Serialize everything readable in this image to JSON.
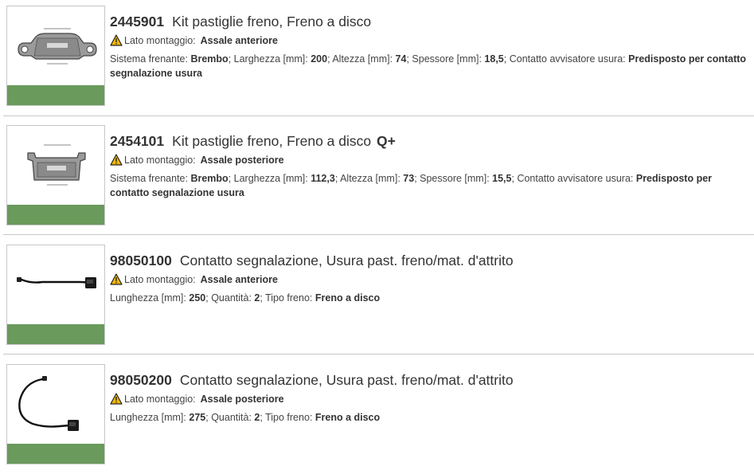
{
  "colors": {
    "accent_bar": "#6a9a5c",
    "separator": "#c8c8c8",
    "warning": "#f2b705"
  },
  "products": [
    {
      "code": "2445901",
      "name": "Kit pastiglie freno, Freno a disco",
      "badge": "",
      "image_icon": "brake-pad-front-icon",
      "mount_label": "Lato montaggio:",
      "mount_value": "Assale anteriore",
      "attributes": [
        {
          "label": "Sistema frenante:",
          "value": "Brembo"
        },
        {
          "label": "Larghezza [mm]:",
          "value": "200"
        },
        {
          "label": "Altezza [mm]:",
          "value": "74"
        },
        {
          "label": "Spessore [mm]:",
          "value": "18,5"
        },
        {
          "label": "Contatto avvisatore usura:",
          "value": "Predisposto per contatto segnalazione usura"
        }
      ]
    },
    {
      "code": "2454101",
      "name": "Kit pastiglie freno, Freno a disco",
      "badge": "Q+",
      "image_icon": "brake-pad-rear-icon",
      "mount_label": "Lato montaggio:",
      "mount_value": "Assale posteriore",
      "attributes": [
        {
          "label": "Sistema frenante:",
          "value": "Brembo"
        },
        {
          "label": "Larghezza [mm]:",
          "value": "112,3"
        },
        {
          "label": "Altezza [mm]:",
          "value": "73"
        },
        {
          "label": "Spessore [mm]:",
          "value": "15,5"
        },
        {
          "label": "Contatto avvisatore usura:",
          "value": "Predisposto per contatto segnalazione usura"
        }
      ]
    },
    {
      "code": "98050100",
      "name": "Contatto segnalazione, Usura past. freno/mat. d'attrito",
      "badge": "",
      "image_icon": "wear-sensor-short-icon",
      "mount_label": "Lato montaggio:",
      "mount_value": "Assale anteriore",
      "attributes": [
        {
          "label": "Lunghezza [mm]:",
          "value": "250"
        },
        {
          "label": "Quantità:",
          "value": "2"
        },
        {
          "label": "Tipo freno:",
          "value": "Freno a disco"
        }
      ]
    },
    {
      "code": "98050200",
      "name": "Contatto segnalazione, Usura past. freno/mat. d'attrito",
      "badge": "",
      "image_icon": "wear-sensor-long-icon",
      "mount_label": "Lato montaggio:",
      "mount_value": "Assale posteriore",
      "attributes": [
        {
          "label": "Lunghezza [mm]:",
          "value": "275"
        },
        {
          "label": "Quantità:",
          "value": "2"
        },
        {
          "label": "Tipo freno:",
          "value": "Freno a disco"
        }
      ]
    }
  ]
}
